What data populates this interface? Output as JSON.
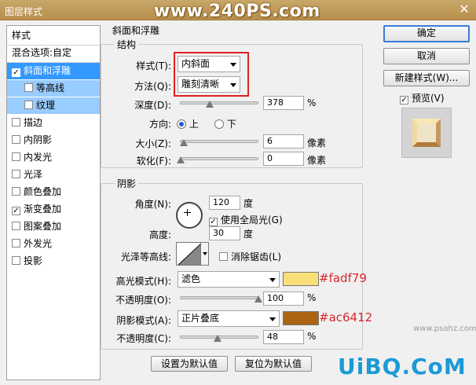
{
  "window": {
    "title": "图层样式",
    "watermark": "www.240PS.com",
    "close": "✕"
  },
  "left_list": {
    "header": "样式",
    "blend": "混合选项:自定",
    "items": [
      {
        "label": "斜面和浮雕",
        "checked": true,
        "selected": true
      },
      {
        "label": "等高线",
        "checked": false,
        "sub": true
      },
      {
        "label": "纹理",
        "checked": false,
        "sub": true
      },
      {
        "label": "描边",
        "checked": false
      },
      {
        "label": "内阴影",
        "checked": false
      },
      {
        "label": "内发光",
        "checked": false
      },
      {
        "label": "光泽",
        "checked": false
      },
      {
        "label": "颜色叠加",
        "checked": false
      },
      {
        "label": "渐变叠加",
        "checked": true
      },
      {
        "label": "图案叠加",
        "checked": false
      },
      {
        "label": "外发光",
        "checked": false
      },
      {
        "label": "投影",
        "checked": false
      }
    ],
    "checkmark": "✓"
  },
  "bevel": {
    "group_title": "斜面和浮雕",
    "structure_title": "结构",
    "style_label": "样式(T):",
    "style_value": "内斜面",
    "technique_label": "方法(Q):",
    "technique_value": "雕刻清晰",
    "depth_label": "深度(D):",
    "depth_value": "378",
    "depth_unit": "%",
    "depth_level": 0.378,
    "direction_label": "方向:",
    "dir_up": "上",
    "dir_down": "下",
    "size_label": "大小(Z):",
    "size_value": "6",
    "size_unit": "像素",
    "soften_label": "软化(F):",
    "soften_value": "0",
    "soften_unit": "像素"
  },
  "shading": {
    "title": "阴影",
    "angle_label": "角度(N):",
    "angle_value": "120",
    "angle_unit": "度",
    "global_light": "使用全局光(G)",
    "altitude_label": "高度:",
    "altitude_value": "30",
    "altitude_unit": "度",
    "gloss_label": "光泽等高线:",
    "antialias": "消除锯齿(L)",
    "highlight_label": "高光模式(H):",
    "highlight_mode": "滤色",
    "highlight_color": "#fadf79",
    "highlight_hex": "#fadf79",
    "opacity1_label": "不透明度(O):",
    "opacity1_value": "100",
    "opacity1_unit": "%",
    "shadow_label": "阴影模式(A):",
    "shadow_mode": "正片叠底",
    "shadow_color": "#ac6412",
    "shadow_hex": "#ac6412",
    "opacity2_label": "不透明度(C):",
    "opacity2_value": "48",
    "opacity2_unit": "%"
  },
  "buttons": {
    "ok": "确定",
    "cancel": "取消",
    "new_style": "新建样式(W)...",
    "preview": "预览(V)",
    "make_default": "设置为默认值",
    "reset_default": "复位为默认值"
  },
  "watermarks": {
    "bottom": "UiBQ.CoM",
    "bottom_url": "www.psahz.com"
  }
}
